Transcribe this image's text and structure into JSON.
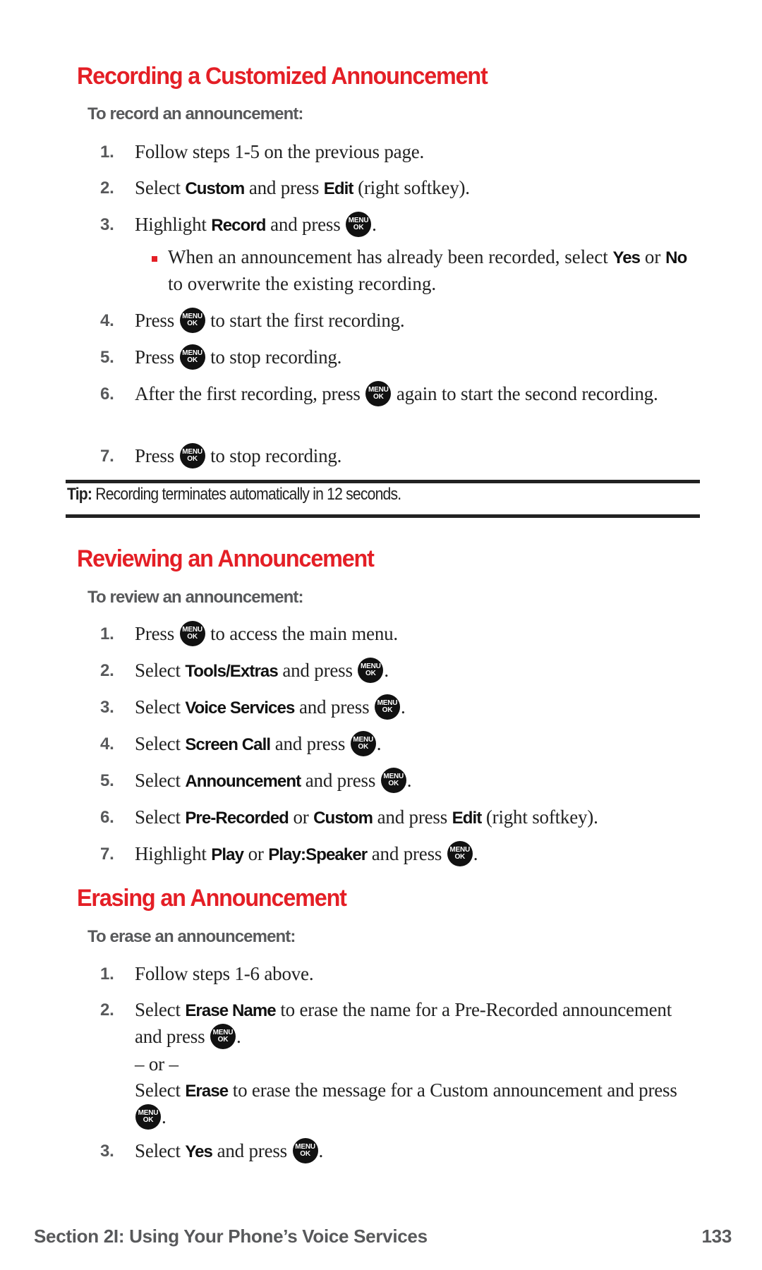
{
  "sections": [
    {
      "title": "Recording a Customized Announcement",
      "subtitle": "To record an announcement:",
      "steps": [
        {
          "num": "1.",
          "parts": [
            "Follow steps 1-5 on the previous page."
          ]
        },
        {
          "num": "2.",
          "pre": "Select ",
          "b1": "Custom",
          "mid": " and press ",
          "b2": "Edit",
          "post": " (right softkey)."
        },
        {
          "num": "3.",
          "pre": "Highlight ",
          "b1": "Record",
          "mid": " and press ",
          "post": "."
        },
        {
          "num": "4.",
          "pre": "Press ",
          "post": " to start the first recording."
        },
        {
          "num": "5.",
          "pre": "Press ",
          "post": " to stop recording."
        },
        {
          "num": "6.",
          "pre": "After the first recording, press ",
          "post": " again to start the second recording."
        },
        {
          "num": "7.",
          "pre": "Press ",
          "post": " to stop recording."
        }
      ],
      "bullet": {
        "pre": "When an announcement has already been recorded, select ",
        "b1": "Yes",
        "mid": " or ",
        "b2": "No",
        "post": " to overwrite the existing recording."
      }
    },
    {
      "title": "Reviewing an Announcement",
      "subtitle": "To review an announcement:",
      "steps": [
        {
          "num": "1.",
          "pre": "Press ",
          "post": " to access the main menu."
        },
        {
          "num": "2.",
          "pre": "Select ",
          "b1": "Tools/Extras",
          "mid": " and press ",
          "post": "."
        },
        {
          "num": "3.",
          "pre": "Select ",
          "b1": "Voice Services",
          "mid": " and press ",
          "post": "."
        },
        {
          "num": "4.",
          "pre": "Select ",
          "b1": "Screen Call",
          "mid": " and press ",
          "post": "."
        },
        {
          "num": "5.",
          "pre": "Select ",
          "b1": "Announcement",
          "mid": " and press ",
          "post": "."
        },
        {
          "num": "6.",
          "pre": "Select ",
          "b1": "Pre-Recorded",
          "mid": " or ",
          "b2": "Custom",
          "mid2": " and press ",
          "b3": "Edit",
          "post": " (right softkey)."
        },
        {
          "num": "7.",
          "pre": "Highlight ",
          "b1": "Play",
          "mid": " or ",
          "b2": "Play:Speaker",
          "mid2": " and press ",
          "post": "."
        }
      ]
    },
    {
      "title": "Erasing an Announcement",
      "subtitle": "To erase an announcement:",
      "steps": [
        {
          "num": "1.",
          "pre": "Follow steps 1-6 above."
        },
        {
          "num": "2.",
          "pre": "Select ",
          "b1": "Erase Name",
          "mid": " to erase the name for a Pre-Recorded announcement and press ",
          "post": ".",
          "or": "– or –",
          "pre2": "Select ",
          "b2": "Erase",
          "mid2": " to erase the message for a Custom announcement and press ",
          "post2": "."
        },
        {
          "num": "3.",
          "pre": "Select ",
          "b1": "Yes",
          "mid": " and press ",
          "post": "."
        }
      ]
    }
  ],
  "tip": {
    "label": "Tip:",
    "text": " Recording terminates automatically in 12 seconds."
  },
  "key_icon": {
    "line1": "MENU",
    "line2": "OK"
  },
  "footer": {
    "section": "Section 2I: Using Your Phone’s Voice Services",
    "page": "133"
  },
  "colors": {
    "heading": "#e41f26",
    "subhead": "#58595b",
    "text": "#222222"
  }
}
